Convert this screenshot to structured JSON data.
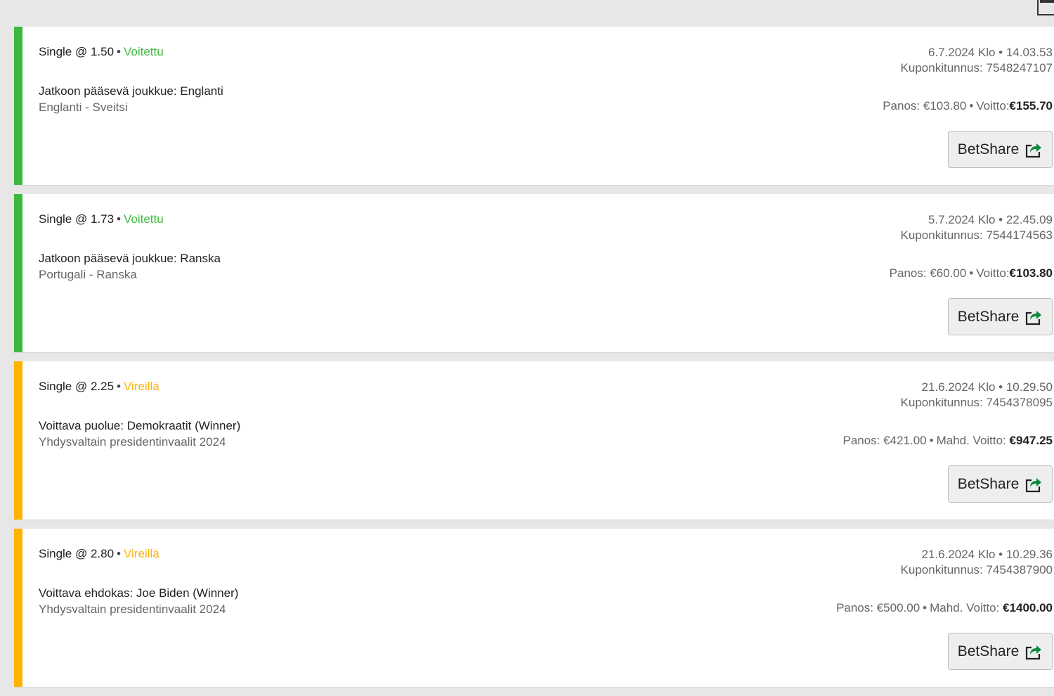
{
  "colors": {
    "won": "#3cb93c",
    "pending": "#ffb300",
    "share_icon": "#0f8a3c"
  },
  "bets": [
    {
      "type": "Single @ 1.50",
      "status": "Voitettu",
      "state": "won",
      "selection": "Jatkoon pääsevä joukkue: Englanti",
      "event": "Englanti - Sveitsi",
      "date": "6.7.2024 Klo • 14.03.53",
      "coupon": "Kuponkitunnus: 7548247107",
      "stake": "Panos: €103.80",
      "win_label": "Voitto:",
      "win_amount": "€155.70",
      "share_label": "BetShare"
    },
    {
      "type": "Single @ 1.73",
      "status": "Voitettu",
      "state": "won",
      "selection": "Jatkoon pääsevä joukkue: Ranska",
      "event": "Portugali - Ranska",
      "date": "5.7.2024 Klo • 22.45.09",
      "coupon": "Kuponkitunnus: 7544174563",
      "stake": "Panos: €60.00",
      "win_label": "Voitto:",
      "win_amount": "€103.80",
      "share_label": "BetShare"
    },
    {
      "type": "Single @ 2.25",
      "status": "Vireillä",
      "state": "pending",
      "selection": "Voittava puolue: Demokraatit (Winner)",
      "event": "Yhdysvaltain presidentinvaalit 2024",
      "date": "21.6.2024 Klo • 10.29.50",
      "coupon": "Kuponkitunnus: 7454378095",
      "stake": "Panos: €421.00",
      "win_label": "Mahd. Voitto:",
      "win_amount": "€947.25",
      "share_label": "BetShare"
    },
    {
      "type": "Single @ 2.80",
      "status": "Vireillä",
      "state": "pending",
      "selection": "Voittava ehdokas: Joe Biden (Winner)",
      "event": "Yhdysvaltain presidentinvaalit 2024",
      "date": "21.6.2024 Klo • 10.29.36",
      "coupon": "Kuponkitunnus: 7454387900",
      "stake": "Panos: €500.00",
      "win_label": "Mahd. Voitto:",
      "win_amount": "€1400.00",
      "share_label": "BetShare"
    }
  ]
}
